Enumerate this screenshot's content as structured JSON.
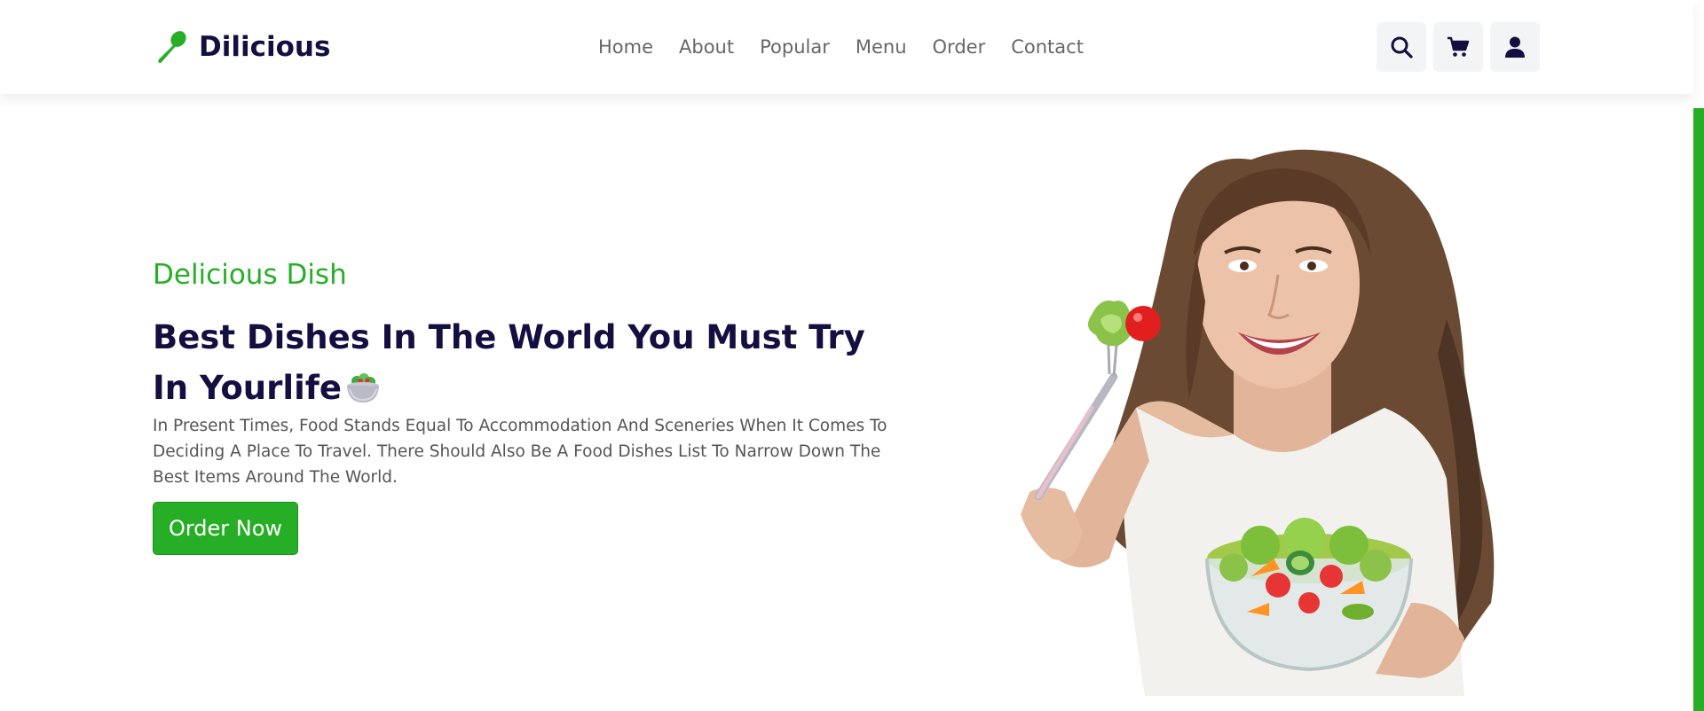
{
  "header": {
    "logo_text": "Dilicious",
    "logo_icon": "spoon-icon",
    "nav": [
      {
        "label": "Home"
      },
      {
        "label": "About"
      },
      {
        "label": "Popular"
      },
      {
        "label": "Menu"
      },
      {
        "label": "Order"
      },
      {
        "label": "Contact"
      }
    ],
    "actions": [
      {
        "icon": "search-icon"
      },
      {
        "icon": "cart-icon"
      },
      {
        "icon": "user-icon"
      }
    ]
  },
  "hero": {
    "subtitle": "Delicious Dish",
    "title": "Best Dishes In The World You Must Try In Yourlife",
    "title_emoji": "salad-bowl-icon",
    "description": "In Present Times, Food Stands Equal To Accommodation And Sceneries When It Comes To Deciding A Place To Travel. There Should Also Be A Food Dishes List To Narrow Down The Best Items Around The World.",
    "button_label": "Order Now",
    "image": "woman-eating-salad-image"
  },
  "colors": {
    "accent": "#27ae27",
    "dark": "#130f40",
    "text": "#666666"
  }
}
